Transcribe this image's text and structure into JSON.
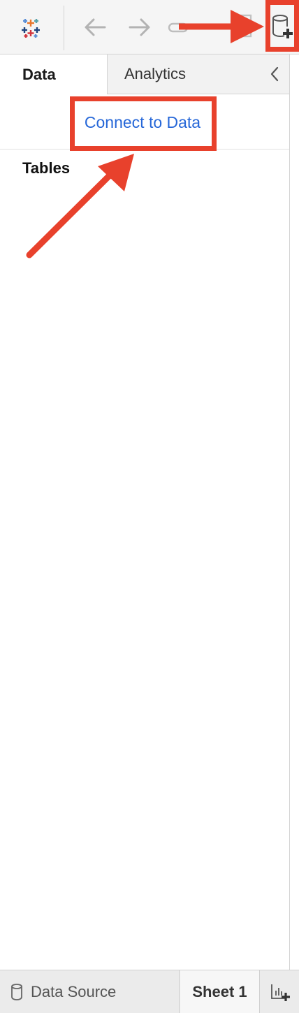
{
  "toolbar": {
    "logo_icon": "tableau-logo-icon",
    "back_icon": "arrow-left-icon",
    "forward_icon": "arrow-right-icon",
    "new_data_source_icon": "database-plus-icon"
  },
  "tabs": {
    "data_label": "Data",
    "analytics_label": "Analytics",
    "collapse_icon": "chevron-left-icon"
  },
  "data_pane": {
    "connect_label": "Connect to Data",
    "tables_heading": "Tables"
  },
  "bottom_bar": {
    "data_source_label": "Data Source",
    "data_source_icon": "database-icon",
    "sheet_label": "Sheet 1",
    "new_sheet_icon": "new-worksheet-icon"
  },
  "colors": {
    "annotation": "#e8412c",
    "link": "#2667d8",
    "logo_orange": "#e8762b",
    "logo_blue": "#5b8fd6",
    "logo_red": "#d1343c",
    "logo_navy": "#1f447e",
    "logo_teal": "#59a2a8"
  }
}
